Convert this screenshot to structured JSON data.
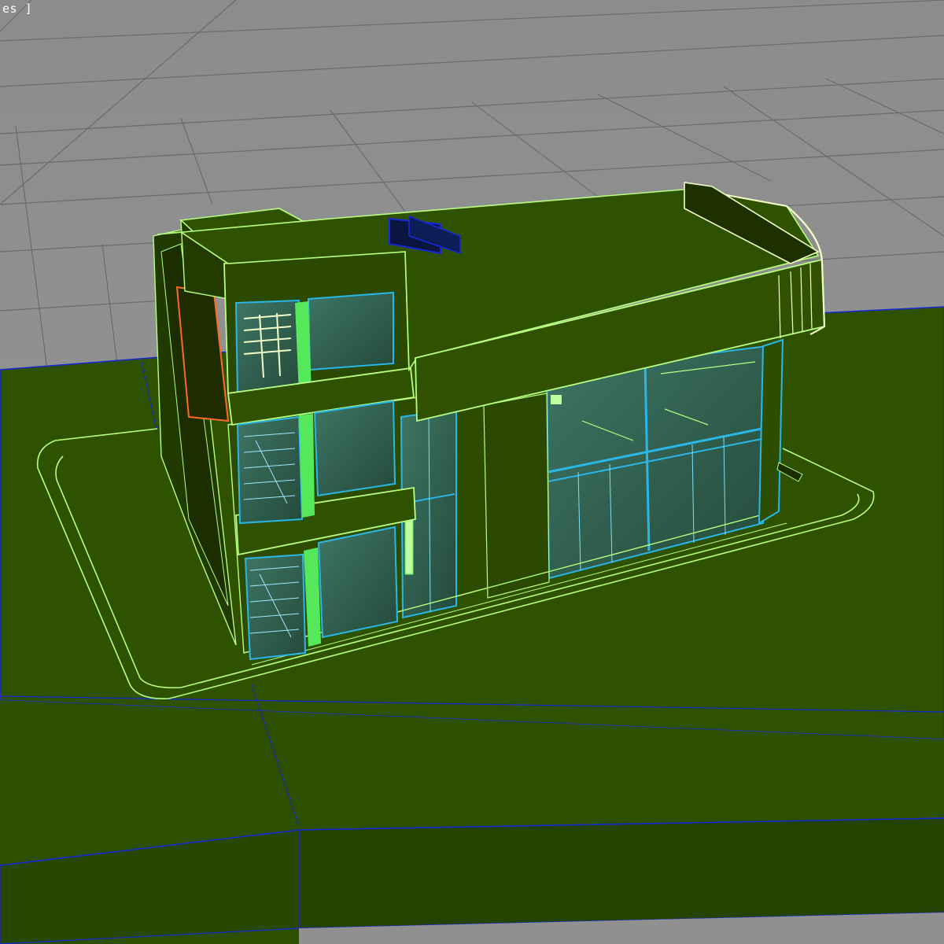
{
  "viewport": {
    "label": "es ]",
    "background_color": "#8f8f8f",
    "grid_color": "#6f6f6f",
    "grid_edge_color": "#2a2a2a"
  },
  "scene": {
    "ground_color": "#2e5200",
    "ground_dark_color": "#254300",
    "wire_color": "#b8ff80",
    "glass_color": "#2e5a4a",
    "glass_edge_color": "#29b7e8",
    "bright_green": "#55e85a",
    "axis_blue": "#1428d8",
    "orange_edge": "#ff6a20",
    "cream_edge": "#f3ffc8"
  }
}
